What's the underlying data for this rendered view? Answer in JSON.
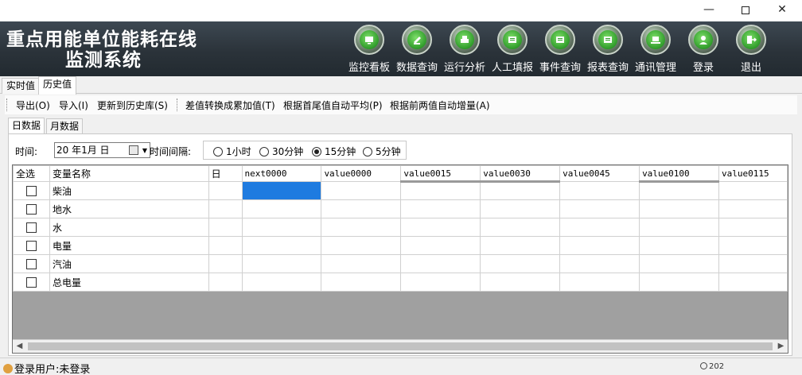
{
  "window": {
    "minimize": "—",
    "close": "✕"
  },
  "app": {
    "title_line1": "重点用能单位能耗在线",
    "title_line2": "监测系统"
  },
  "nav": [
    {
      "label": "监控看板",
      "icon": "monitor-icon"
    },
    {
      "label": "数据查询",
      "icon": "satellite-icon"
    },
    {
      "label": "运行分析",
      "icon": "printer-icon"
    },
    {
      "label": "人工填报",
      "icon": "screen-icon"
    },
    {
      "label": "事件查询",
      "icon": "screen-icon"
    },
    {
      "label": "报表查询",
      "icon": "screen-icon"
    },
    {
      "label": "通讯管理",
      "icon": "laptop-icon"
    },
    {
      "label": "登录",
      "icon": "user-icon"
    },
    {
      "label": "退出",
      "icon": "exit-icon"
    }
  ],
  "tabs": [
    {
      "label": "实时值"
    },
    {
      "label": "历史值"
    }
  ],
  "toolbar": [
    {
      "label": "导出(O)"
    },
    {
      "label": "导入(I)"
    },
    {
      "label": "更新到历史库(S)"
    },
    {
      "label": "差值转换成累加值(T)"
    },
    {
      "label": "根据首尾值自动平均(P)"
    },
    {
      "label": "根据前两值自动增量(A)"
    }
  ],
  "subtabs": [
    {
      "label": "日数据"
    },
    {
      "label": "月数据"
    }
  ],
  "filter": {
    "time_label": "时间:",
    "date_value": "20 年1月 日",
    "interval_label": "时间间隔:",
    "options": [
      {
        "label": "1小时"
      },
      {
        "label": "30分钟"
      },
      {
        "label": "15分钟"
      },
      {
        "label": "5分钟"
      }
    ],
    "selected": "15分钟"
  },
  "grid": {
    "headers": [
      "全选",
      "变量名称",
      "日",
      "next0000",
      "value0000",
      "value0015",
      "value0030",
      "value0045",
      "value0100",
      "value0115"
    ],
    "rows": [
      {
        "name": "柴油"
      },
      {
        "name": "地水"
      },
      {
        "name": "水"
      },
      {
        "name": "电量"
      },
      {
        "name": "汽油"
      },
      {
        "name": "总电量"
      }
    ]
  },
  "status": {
    "user": "登录用户:未登录",
    "clock": "202"
  }
}
